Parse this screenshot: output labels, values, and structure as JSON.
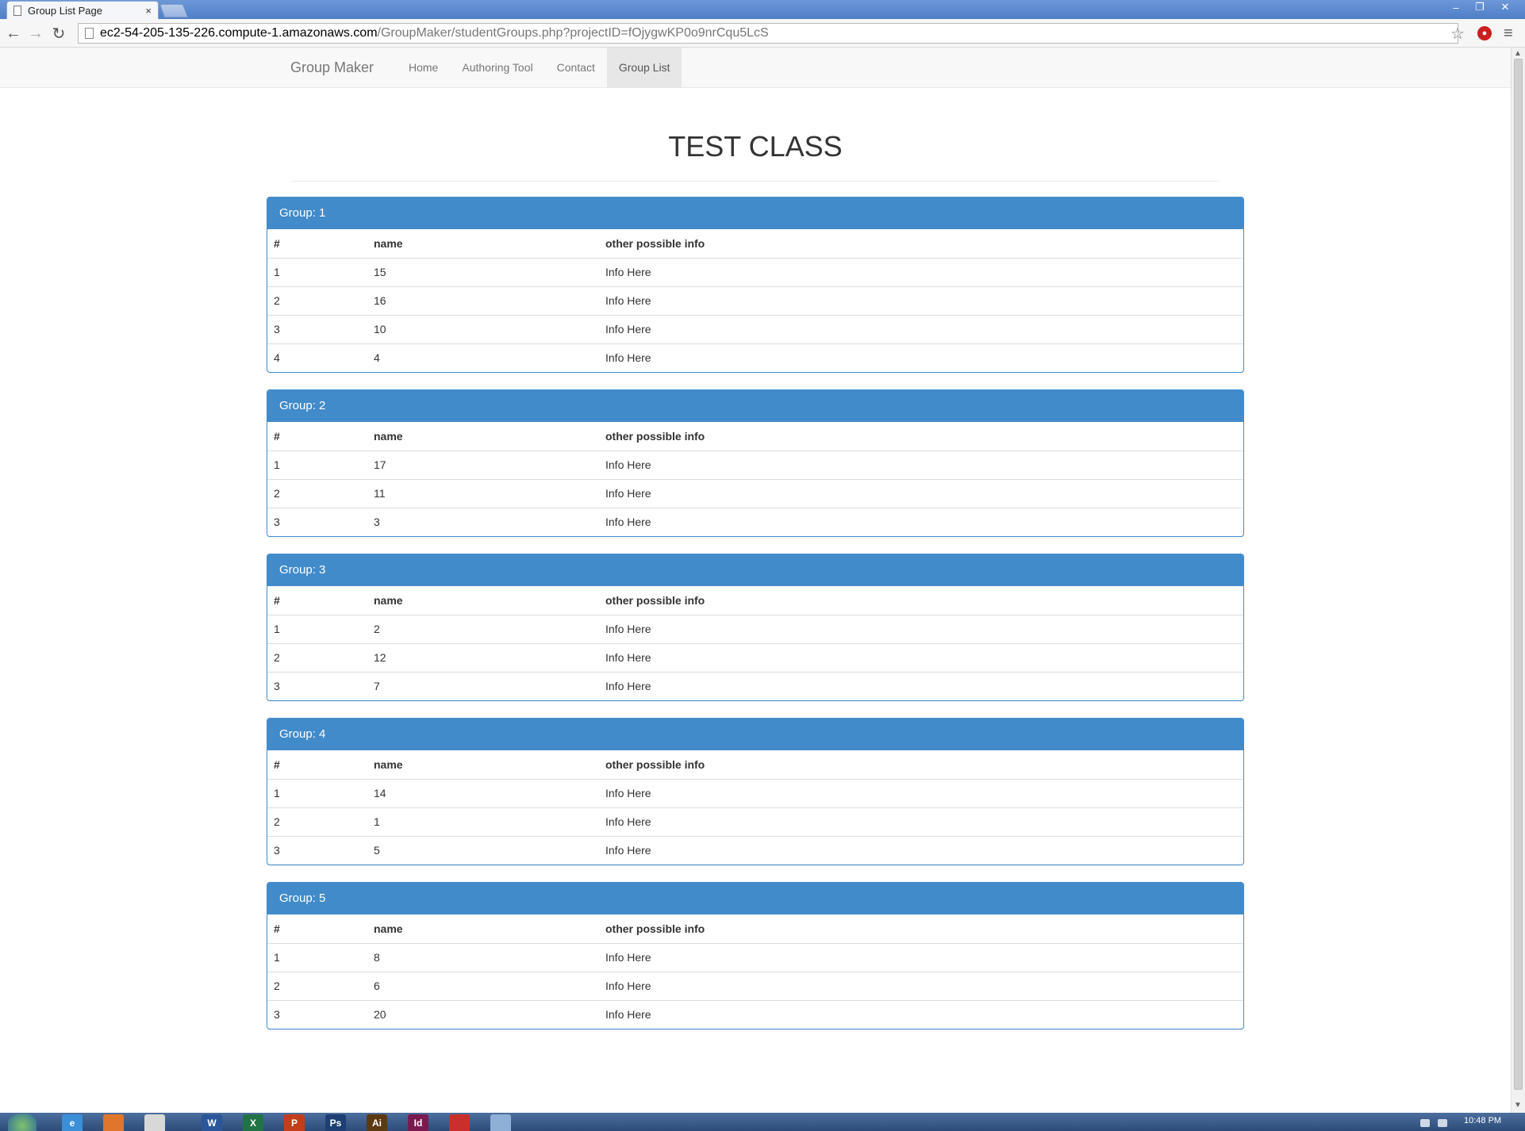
{
  "browser": {
    "tab_title": "Group List Page",
    "tab_close": "×",
    "url_host": "ec2-54-205-135-226.compute-1.amazonaws.com",
    "url_path": "/GroupMaker/studentGroups.php?projectID=fOjygwKP0o9nrCqu5LcS"
  },
  "nav": {
    "brand": "Group Maker",
    "links": [
      "Home",
      "Authoring Tool",
      "Contact",
      "Group List"
    ],
    "active": "Group List"
  },
  "page": {
    "title": "TEST CLASS"
  },
  "columns": [
    "#",
    "name",
    "other possible info"
  ],
  "groups": [
    {
      "title": "Group: 1",
      "rows": [
        [
          "1",
          "15",
          "Info Here"
        ],
        [
          "2",
          "16",
          "Info Here"
        ],
        [
          "3",
          "10",
          "Info Here"
        ],
        [
          "4",
          "4",
          "Info Here"
        ]
      ]
    },
    {
      "title": "Group: 2",
      "rows": [
        [
          "1",
          "17",
          "Info Here"
        ],
        [
          "2",
          "11",
          "Info Here"
        ],
        [
          "3",
          "3",
          "Info Here"
        ]
      ]
    },
    {
      "title": "Group: 3",
      "rows": [
        [
          "1",
          "2",
          "Info Here"
        ],
        [
          "2",
          "12",
          "Info Here"
        ],
        [
          "3",
          "7",
          "Info Here"
        ]
      ]
    },
    {
      "title": "Group: 4",
      "rows": [
        [
          "1",
          "14",
          "Info Here"
        ],
        [
          "2",
          "1",
          "Info Here"
        ],
        [
          "3",
          "5",
          "Info Here"
        ]
      ]
    },
    {
      "title": "Group: 5",
      "rows": [
        [
          "1",
          "8",
          "Info Here"
        ],
        [
          "2",
          "6",
          "Info Here"
        ],
        [
          "3",
          "20",
          "Info Here"
        ]
      ]
    }
  ],
  "taskbar": {
    "clock": "10:48 PM",
    "apps": [
      {
        "name": "ie",
        "label": "e",
        "color": "#3a8fd8"
      },
      {
        "name": "firefox",
        "label": "",
        "color": "#e0762b"
      },
      {
        "name": "chrome",
        "label": "",
        "color": "#d8d8d8"
      },
      {
        "name": "word",
        "label": "W",
        "color": "#2b579a"
      },
      {
        "name": "excel",
        "label": "X",
        "color": "#217346"
      },
      {
        "name": "powerpoint",
        "label": "P",
        "color": "#c43e1c"
      },
      {
        "name": "photoshop",
        "label": "Ps",
        "color": "#1d3f73"
      },
      {
        "name": "illustrator",
        "label": "Ai",
        "color": "#5b3a12"
      },
      {
        "name": "indesign",
        "label": "Id",
        "color": "#7a1b4f"
      },
      {
        "name": "acrobat",
        "label": "",
        "color": "#c9302c"
      },
      {
        "name": "paint",
        "label": "",
        "color": "#8fb0d6"
      }
    ]
  }
}
